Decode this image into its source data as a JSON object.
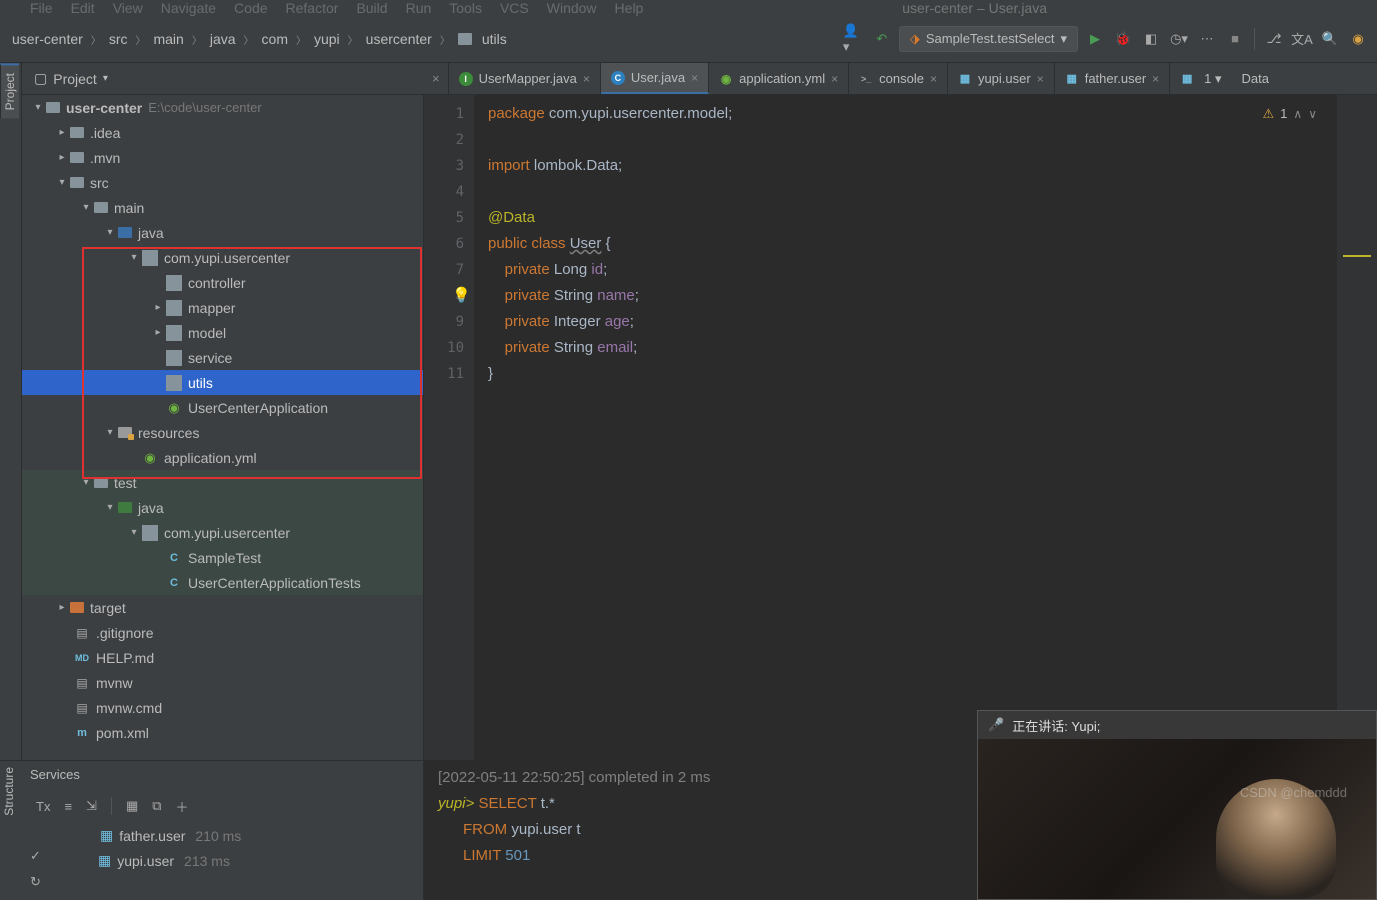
{
  "menubar": {
    "items": [
      "File",
      "Edit",
      "View",
      "Navigate",
      "Code",
      "Refactor",
      "Build",
      "Run",
      "Tools",
      "VCS",
      "Window",
      "Help"
    ],
    "title": "user-center – User.java"
  },
  "breadcrumb": [
    "user-center",
    "src",
    "main",
    "java",
    "com",
    "yupi",
    "usercenter",
    "utils"
  ],
  "run_config": "SampleTest.testSelect",
  "proj": {
    "title": "Project"
  },
  "tree": {
    "root": {
      "name": "user-center",
      "path": "E:\\code\\user-center"
    },
    "idea": ".idea",
    "mvn": ".mvn",
    "src": "src",
    "main": "main",
    "main_java": "java",
    "pkg": "com.yupi.usercenter",
    "controller": "controller",
    "mapper": "mapper",
    "model": "model",
    "service": "service",
    "utils": "utils",
    "app": "UserCenterApplication",
    "resources": "resources",
    "appyml": "application.yml",
    "test": "test",
    "test_java": "java",
    "test_pkg": "com.yupi.usercenter",
    "sampletest": "SampleTest",
    "apptests": "UserCenterApplicationTests",
    "target": "target",
    "gitignore": ".gitignore",
    "help": "HELP.md",
    "mvnw": "mvnw",
    "mvnwcmd": "mvnw.cmd",
    "pom": "pom.xml"
  },
  "tabs": [
    {
      "label": "UserMapper.java",
      "kind": "interface"
    },
    {
      "label": "User.java",
      "kind": "class",
      "active": true
    },
    {
      "label": "application.yml",
      "kind": "yml"
    },
    {
      "label": "console",
      "kind": "console"
    },
    {
      "label": "yupi.user",
      "kind": "db"
    },
    {
      "label": "father.user",
      "kind": "db"
    }
  ],
  "editor": {
    "warnings": "1",
    "lines": {
      "l1": "package com.yupi.usercenter.model;",
      "l3": "import lombok.Data;",
      "l5": "@Data",
      "l6": "public class User {",
      "l7": "    private Long id;",
      "l8": "    private String name;",
      "l9": "    private Integer age;",
      "l10": "    private String email;",
      "l11": "}"
    }
  },
  "services": {
    "title": "Services",
    "father": {
      "name": "father.user",
      "time": "210 ms"
    },
    "yupi": {
      "name": "yupi.user",
      "time": "213 ms"
    },
    "log_ts": "[2022-05-11 22:50:25] completed in 2 ms",
    "prompt": "yupi>",
    "sql1": "SELECT t.*",
    "sql2": "FROM yupi.user t",
    "sql3": "LIMIT 501"
  },
  "cam": {
    "status": "正在讲话: Yupi;"
  },
  "watermark": "CSDN @chemddd"
}
